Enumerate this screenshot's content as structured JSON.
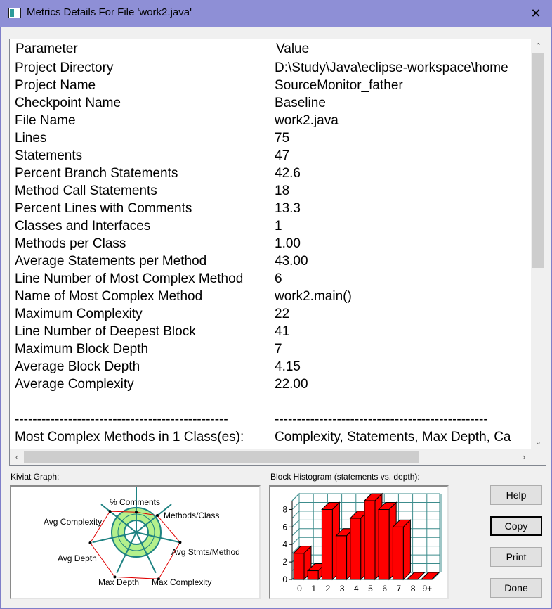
{
  "window": {
    "title": "Metrics Details For File 'work2.java'",
    "close_glyph": "✕"
  },
  "table": {
    "headers": [
      "Parameter",
      "Value"
    ],
    "rows": [
      [
        "Project Directory",
        "D:\\Study\\Java\\eclipse-workspace\\home"
      ],
      [
        "Project Name",
        "SourceMonitor_father"
      ],
      [
        "Checkpoint Name",
        "Baseline"
      ],
      [
        "File Name",
        "work2.java"
      ],
      [
        "Lines",
        "75"
      ],
      [
        "Statements",
        "47"
      ],
      [
        "Percent Branch Statements",
        "42.6"
      ],
      [
        "Method Call Statements",
        "18"
      ],
      [
        "Percent Lines with Comments",
        "13.3"
      ],
      [
        "Classes and Interfaces",
        "1"
      ],
      [
        "Methods per Class",
        "1.00"
      ],
      [
        "Average Statements per Method",
        "43.00"
      ],
      [
        "Line Number of Most Complex Method",
        "6"
      ],
      [
        "Name of Most Complex Method",
        "work2.main()"
      ],
      [
        "Maximum Complexity",
        "22"
      ],
      [
        "Line Number of Deepest Block",
        "41"
      ],
      [
        "Maximum Block Depth",
        "7"
      ],
      [
        "Average Block Depth",
        "4.15"
      ],
      [
        "Average Complexity",
        "22.00"
      ],
      [
        "",
        ""
      ],
      [
        "------------------------------------------------",
        "------------------------------------------------"
      ],
      [
        "Most Complex Methods in 1 Class(es):",
        "Complexity, Statements, Max Depth, Ca"
      ]
    ]
  },
  "scroll_glyphs": {
    "up": "⌃",
    "down": "⌄",
    "left": "‹",
    "right": "›"
  },
  "kiviat": {
    "label": "Kiviat Graph:",
    "axes": [
      "% Comments",
      "Methods/Class",
      "Avg Stmts/Method",
      "Max Complexity",
      "Max Depth",
      "Avg Depth",
      "Avg Complexity"
    ],
    "ring_color": "#b4f08c",
    "ring_border": "#1e8282",
    "polygon_color": "#e00000"
  },
  "histogram": {
    "label": "Block Histogram (statements vs. depth):",
    "categories": [
      "0",
      "1",
      "2",
      "3",
      "4",
      "5",
      "6",
      "7",
      "8",
      "9+"
    ],
    "values": [
      3,
      1,
      8,
      5,
      7,
      9,
      8,
      6,
      0,
      0
    ],
    "ymax": 9,
    "yticks": [
      "0",
      "2",
      "4",
      "6",
      "8"
    ],
    "bar_color": "#ff0000",
    "grid_color": "#3c8c8c"
  },
  "buttons": {
    "help": "Help",
    "copy": "Copy",
    "print": "Print",
    "done": "Done"
  }
}
